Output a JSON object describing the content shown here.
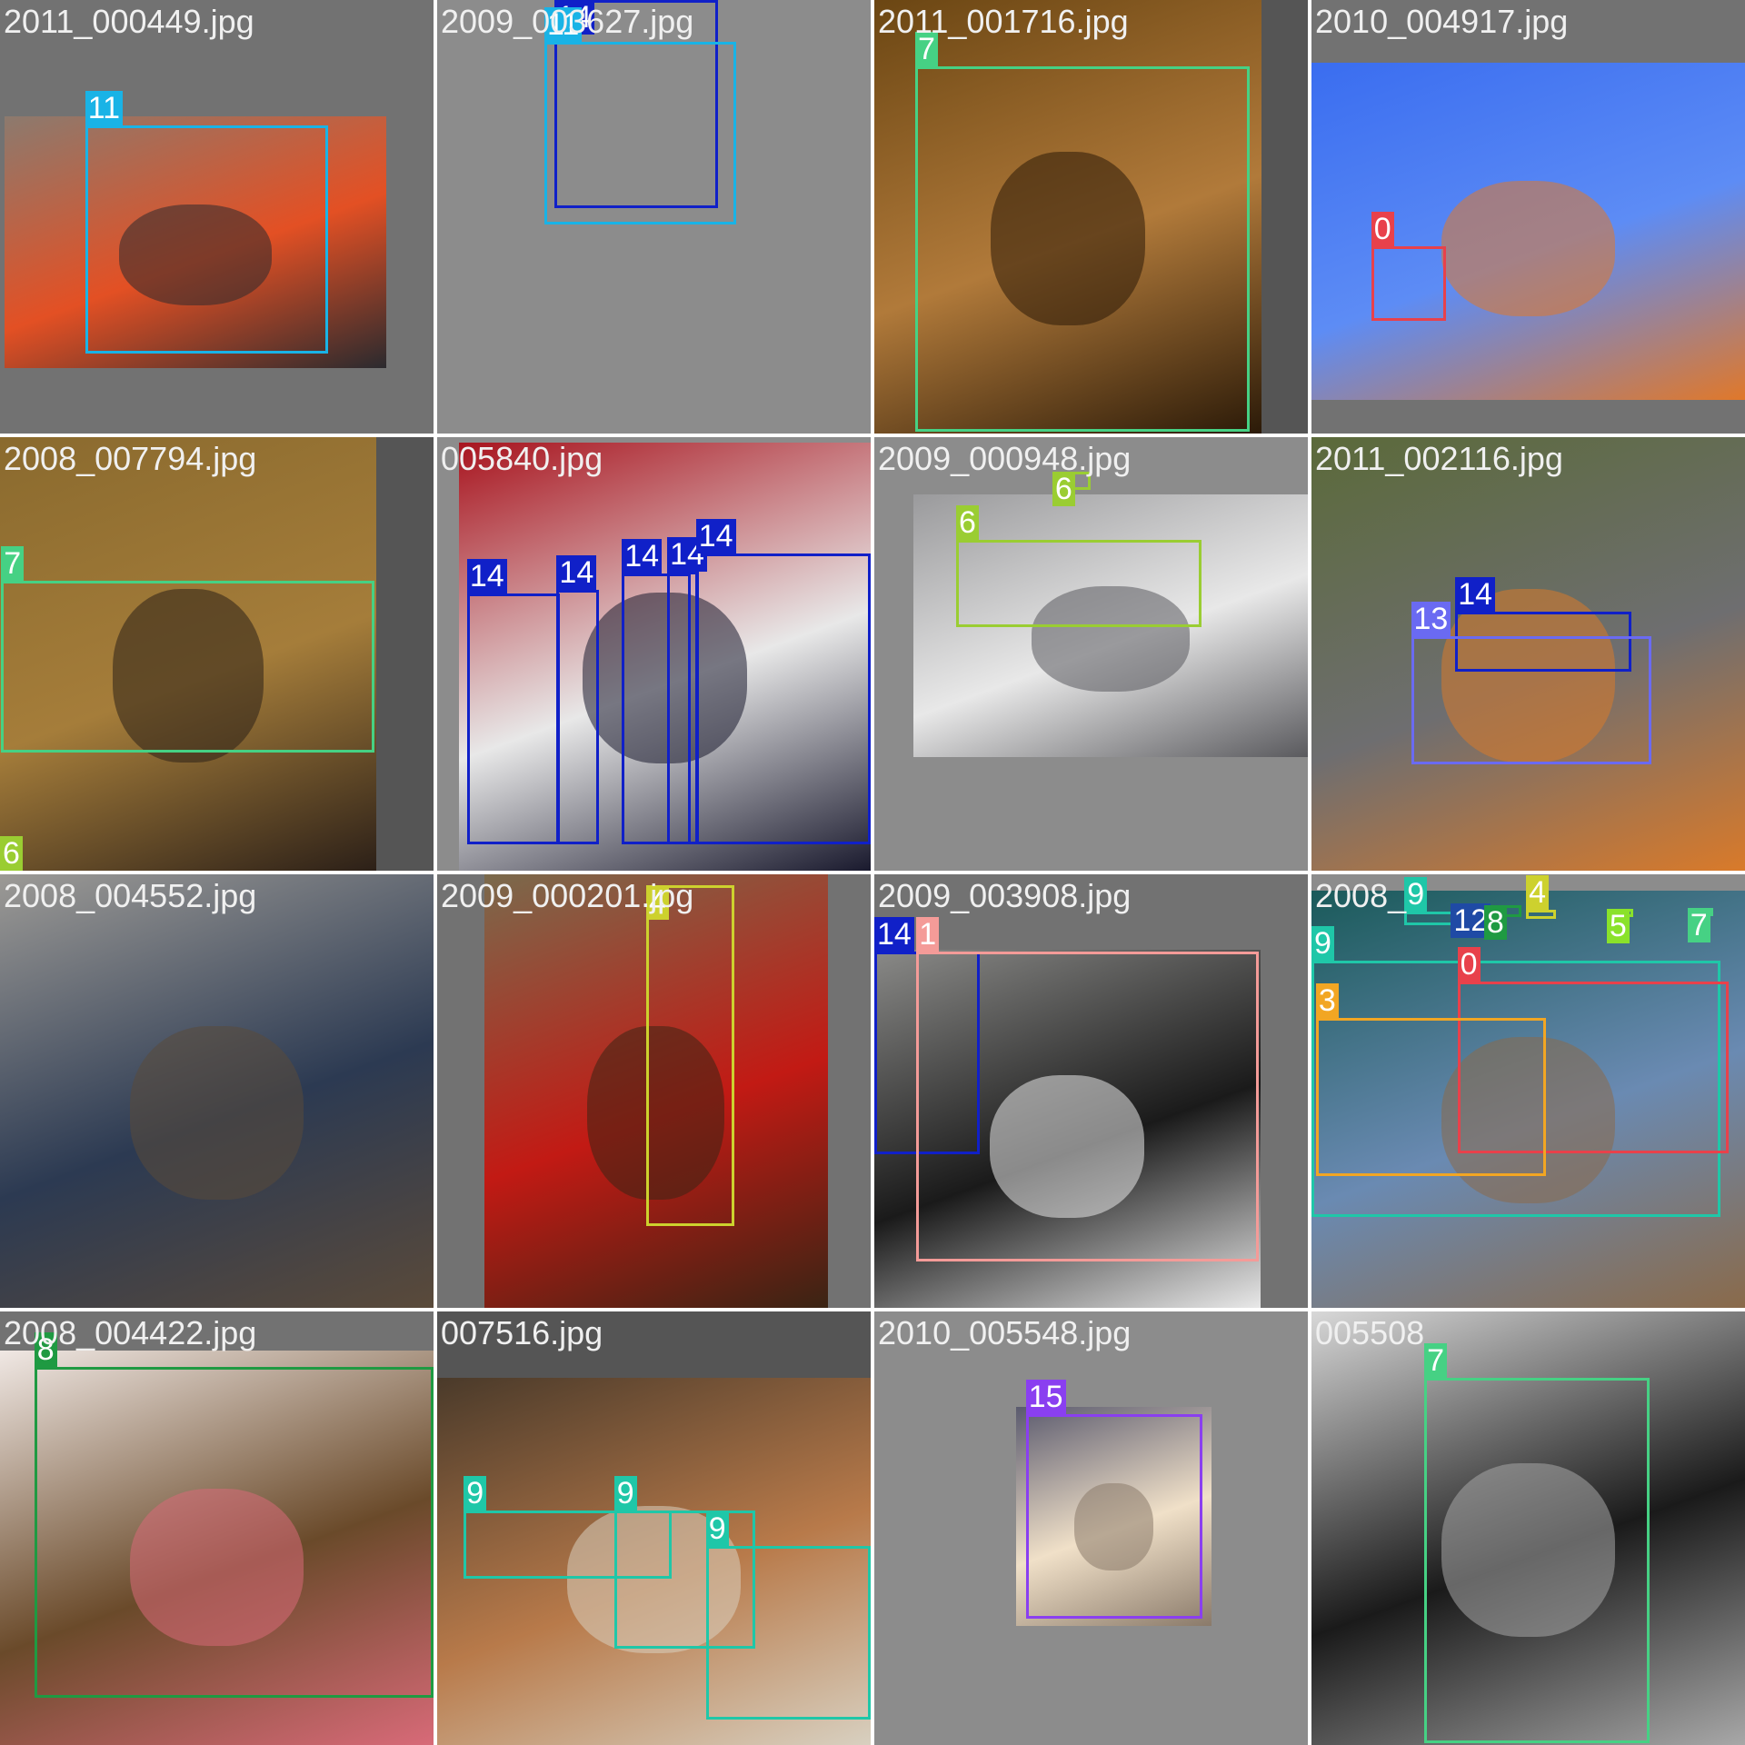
{
  "class_colors": {
    "0": "#e8414b",
    "1": "#f49b98",
    "3": "#f2a623",
    "4": "#cdd12e",
    "5": "#8ae22a",
    "6": "#9acd32",
    "7": "#46d184",
    "8": "#1f9a42",
    "9": "#1fc7a8",
    "11": "#19b3e6",
    "12": "#1f4aa5",
    "13": "#6a6af2",
    "14": "#1020c8",
    "15": "#8a3ff0"
  },
  "tiles": [
    {
      "filename": "2011_000449.jpg",
      "photo_colors": [
        "#8c7a6e",
        "#e35024",
        "#2b2a2e"
      ],
      "subject_icon": "dog-on-orange-cushion",
      "labels": [
        {
          "text": "11",
          "class_id": "11"
        }
      ]
    },
    {
      "filename": "2009_003627.jpg",
      "photo_colors": [
        "#eeeeee",
        "#ffffff",
        "#1a1a1a"
      ],
      "subject_icon": "white-dog-with-handler",
      "labels": [
        {
          "text": "14",
          "class_id": "14"
        },
        {
          "text": "11",
          "class_id": "11"
        }
      ]
    },
    {
      "filename": "2011_001716.jpg",
      "photo_colors": [
        "#6b4613",
        "#b17a3a",
        "#2b1a08"
      ],
      "subject_icon": "tabby-cat",
      "labels": [
        {
          "text": "7",
          "class_id": "7"
        }
      ]
    },
    {
      "filename": "2010_004917.jpg",
      "photo_colors": [
        "#3a6df0",
        "#5d8cf5",
        "#e0782a"
      ],
      "subject_icon": "aeroplane-in-sky",
      "labels": [
        {
          "text": "0",
          "class_id": "0"
        }
      ]
    },
    {
      "filename": "2008_007794.jpg",
      "photo_colors": [
        "#8a6a2e",
        "#a57d3a",
        "#2c2018"
      ],
      "subject_icon": "cat-on-sofa",
      "labels": [
        {
          "text": "7",
          "class_id": "7"
        },
        {
          "text": "6",
          "class_id": "6"
        }
      ]
    },
    {
      "filename": "005840.jpg",
      "photo_colors": [
        "#a8141e",
        "#e8e8e8",
        "#1a1a2e"
      ],
      "subject_icon": "children-in-santa-hats",
      "labels": [
        {
          "text": "14",
          "class_id": "14"
        },
        {
          "text": "14",
          "class_id": "14"
        },
        {
          "text": "14",
          "class_id": "14"
        },
        {
          "text": "14",
          "class_id": "14"
        },
        {
          "text": "14",
          "class_id": "14"
        }
      ]
    },
    {
      "filename": "2009_000948.jpg",
      "photo_colors": [
        "#9a9a9c",
        "#e8e8e8",
        "#5a5a5e"
      ],
      "subject_icon": "drifting-car",
      "labels": [
        {
          "text": "6",
          "class_id": "6"
        },
        {
          "text": "6",
          "class_id": "6"
        }
      ]
    },
    {
      "filename": "2011_002116.jpg",
      "photo_colors": [
        "#5b6a3a",
        "#6e6e70",
        "#d97a2a"
      ],
      "subject_icon": "motorbike-racer",
      "labels": [
        {
          "text": "14",
          "class_id": "14"
        },
        {
          "text": "13",
          "class_id": "13"
        }
      ]
    },
    {
      "filename": "2008_004552.jpg",
      "photo_colors": [
        "#9c9a96",
        "#2c3a52",
        "#5a4a3a"
      ],
      "subject_icon": "car-and-tree",
      "labels": []
    },
    {
      "filename": "2009_000201.jpg",
      "photo_colors": [
        "#7a6a4c",
        "#c21a14",
        "#3a2414"
      ],
      "subject_icon": "bottle-and-glass",
      "labels": [
        {
          "text": "4",
          "class_id": "4"
        }
      ]
    },
    {
      "filename": "2009_003908.jpg",
      "photo_colors": [
        "#8a8a88",
        "#1a1a1a",
        "#e8e8e8"
      ],
      "subject_icon": "bicycle-and-person",
      "labels": [
        {
          "text": "14",
          "class_id": "14"
        },
        {
          "text": "1",
          "class_id": "1"
        }
      ]
    },
    {
      "filename": "2008_004324.jpg",
      "filename_visible": "2008_",
      "photo_colors": [
        "#1a5a5a",
        "#6a8ab2",
        "#8a6a4a"
      ],
      "subject_icon": "man-and-dog-in-car",
      "labels": [
        {
          "text": "9",
          "class_id": "9"
        },
        {
          "text": "12",
          "class_id": "12"
        },
        {
          "text": "8",
          "class_id": "8"
        },
        {
          "text": "4",
          "class_id": "4"
        },
        {
          "text": "5",
          "class_id": "5"
        },
        {
          "text": "7",
          "class_id": "7"
        },
        {
          "text": "9",
          "class_id": "9"
        },
        {
          "text": "0",
          "class_id": "0"
        },
        {
          "text": "3",
          "class_id": "3"
        }
      ]
    },
    {
      "filename": "2008_004422.jpg",
      "photo_colors": [
        "#f0e8e4",
        "#6a4a2a",
        "#d86a78"
      ],
      "subject_icon": "yawning-cat",
      "labels": [
        {
          "text": "8",
          "class_id": "8"
        }
      ]
    },
    {
      "filename": "007516.jpg",
      "photo_colors": [
        "#4a3a2a",
        "#b87a4a",
        "#d8d0c0"
      ],
      "subject_icon": "cows-in-barn",
      "labels": [
        {
          "text": "9",
          "class_id": "9"
        },
        {
          "text": "9",
          "class_id": "9"
        },
        {
          "text": "9",
          "class_id": "9"
        }
      ]
    },
    {
      "filename": "2010_005548.jpg",
      "photo_colors": [
        "#5a5a6e",
        "#f0e0c8",
        "#8a7a6a"
      ],
      "subject_icon": "pomeranian-dog",
      "labels": [
        {
          "text": "15",
          "class_id": "15"
        }
      ]
    },
    {
      "filename": "005508",
      "photo_colors": [
        "#d8d8d8",
        "#1a1a1a",
        "#a8a8a8"
      ],
      "subject_icon": "seated-person-grayscale",
      "labels": [
        {
          "text": "7",
          "class_id": "7"
        }
      ]
    }
  ]
}
